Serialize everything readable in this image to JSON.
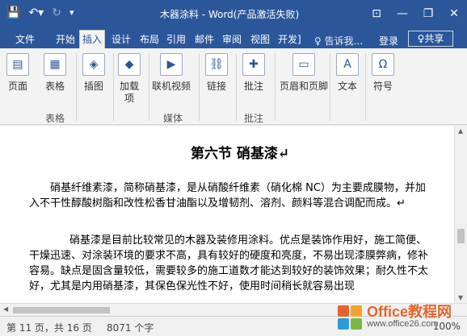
{
  "title_bar": {
    "title": "木器涂料 - Word(产品激活失败)",
    "icons": [
      "save-icon",
      "undo-icon",
      "redo-icon",
      "customize-qat-icon"
    ],
    "controls": [
      "ribbon-display-icon",
      "minimize-icon",
      "restore-icon",
      "close-icon"
    ],
    "control_glyphs": [
      "⊡",
      "—",
      "❐",
      "✕"
    ],
    "qat_glyphs": [
      "💾",
      "↶▾",
      "↻",
      "▾"
    ]
  },
  "tabs": [
    "文件",
    "开始",
    "插入",
    "设计",
    "布局",
    "引用",
    "邮件",
    "审阅",
    "视图",
    "开发]"
  ],
  "active_tab": "插入",
  "tell_me": "♀ 告诉我...",
  "login": "登录",
  "share": "♀共享",
  "ribbon": {
    "buttons": [
      {
        "label": "页面",
        "icon": "page-icon",
        "glyph": "▤"
      },
      {
        "label": "表格",
        "icon": "table-icon",
        "glyph": "▦"
      },
      {
        "label": "插图",
        "icon": "illustration-icon",
        "glyph": "◈"
      },
      {
        "label": "加载\n项",
        "icon": "addins-icon",
        "glyph": "◆"
      },
      {
        "label": "联机视频",
        "icon": "online-video-icon",
        "glyph": "▶"
      },
      {
        "label": "链接",
        "icon": "link-icon",
        "glyph": "⛓"
      },
      {
        "label": "批注",
        "icon": "comment-icon",
        "glyph": "✚"
      },
      {
        "label": "页眉和页脚",
        "icon": "header-footer-icon",
        "glyph": "▭"
      },
      {
        "label": "文本",
        "icon": "text-icon",
        "glyph": "A"
      },
      {
        "label": "符号",
        "icon": "symbol-icon",
        "glyph": "Ω"
      }
    ],
    "groups": [
      "表格",
      "媒体",
      "批注"
    ]
  },
  "document": {
    "heading": "第六节  硝基漆↵",
    "para1": "硝基纤维素漆，简称硝基漆，是从硝酸纤维素（硝化棉 NC）为主要成膜物，并加入不干性醇酸树脂和改性松香甘油酯以及增韧剂、溶剂、颜料等混合调配而成。↵",
    "para2": "硝基漆是目前比较常见的木器及装修用涂料。优点是装饰作用好，施工简便、干燥迅速、对涂装环境的要求不高，具有较好的硬度和亮度，不易出现漆膜弊病，修补容易。缺点是固含量较低，需要较多的施工道数才能达到较好的装饰效果；耐久性不太好，尤其是内用硝基漆，其保色保光性不好，使用时间稍长就容易出现"
  },
  "status": {
    "page": "第 11 页，共 16 页",
    "words": "8071 个字",
    "zoom": "100%"
  },
  "watermark": {
    "main": "Office教程网",
    "sub": "www.office26.com",
    "colors": [
      "#e8632b",
      "#f3a22b",
      "#2f9bd6",
      "#7ab648"
    ]
  }
}
